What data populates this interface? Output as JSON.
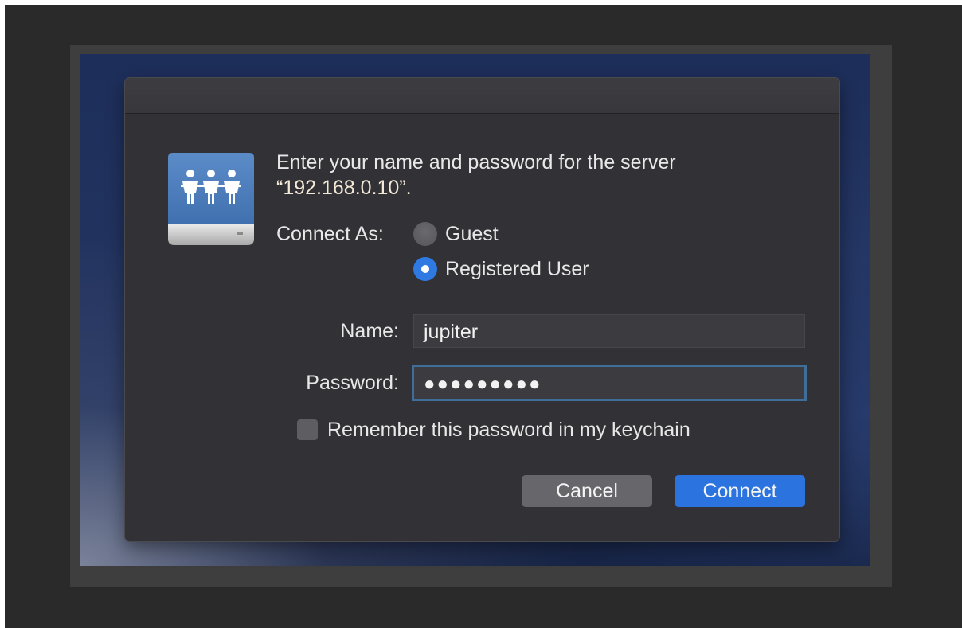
{
  "dialog": {
    "prompt_line1": "Enter your name and password for the server",
    "prompt_line2": "“192.168.0.10”.",
    "connect_as_label": "Connect As:",
    "options": {
      "guest": "Guest",
      "registered": "Registered User",
      "selected": "Registered User"
    },
    "name_label": "Name:",
    "name_value": "jupiter",
    "password_label": "Password:",
    "password_value": "●●●●●●●●●",
    "remember_label": "Remember this password in my keychain",
    "remember_checked": false,
    "cancel_label": "Cancel",
    "connect_label": "Connect"
  },
  "colors": {
    "accent": "#2b74e0",
    "dialog_bg": "#323236",
    "focus_ring": "#3f6e9a"
  },
  "icons": {
    "server": "network-server-icon"
  }
}
